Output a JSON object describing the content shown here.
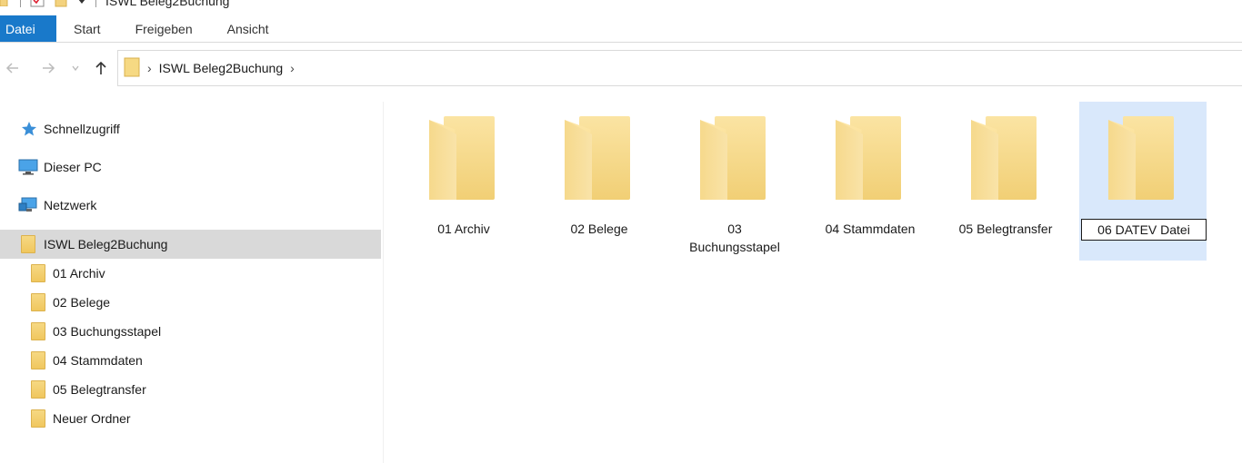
{
  "window": {
    "title": "ISWL Beleg2Buchung"
  },
  "ribbon": {
    "tabs": [
      {
        "label": "Datei",
        "active": true
      },
      {
        "label": "Start"
      },
      {
        "label": "Freigeben"
      },
      {
        "label": "Ansicht"
      }
    ]
  },
  "address": {
    "path": [
      "ISWL Beleg2Buchung"
    ]
  },
  "sidebar": {
    "top_items": [
      {
        "label": "Schnellzugriff",
        "icon": "star-icon"
      },
      {
        "label": "Dieser PC",
        "icon": "monitor-icon"
      },
      {
        "label": "Netzwerk",
        "icon": "network-icon"
      }
    ],
    "current": {
      "label": "ISWL Beleg2Buchung",
      "icon": "folder-icon"
    },
    "children": [
      {
        "label": "01 Archiv"
      },
      {
        "label": "02 Belege"
      },
      {
        "label": "03 Buchungsstapel"
      },
      {
        "label": "04 Stammdaten"
      },
      {
        "label": "05 Belegtransfer"
      },
      {
        "label": "Neuer Ordner"
      }
    ]
  },
  "content": {
    "folders": [
      {
        "label": "01 Archiv"
      },
      {
        "label": "02 Belege"
      },
      {
        "label": "03 Buchungsstapel"
      },
      {
        "label": "04 Stammdaten"
      },
      {
        "label": "05 Belegtransfer"
      },
      {
        "label": "06 DATEV Datei",
        "selected": true,
        "renaming": true
      }
    ]
  },
  "colors": {
    "accent": "#1979ca",
    "selection": "#d9e8fb",
    "sidebar_selected": "#d9d9d9",
    "folder": "#f3d27e"
  }
}
